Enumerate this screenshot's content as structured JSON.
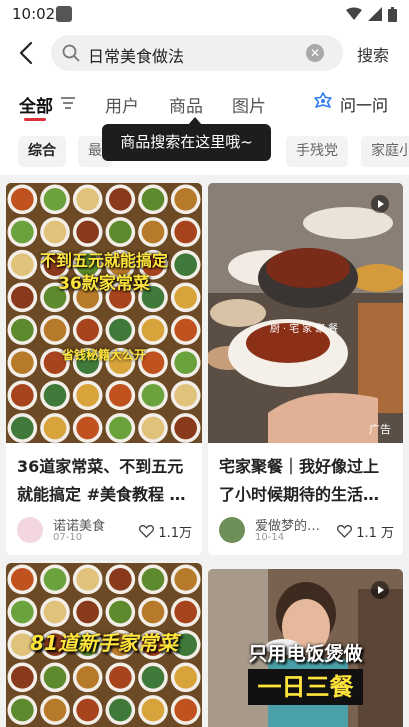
{
  "status": {
    "time": "10:02"
  },
  "search": {
    "query": "日常美食做法",
    "submit_label": "搜索"
  },
  "tabs": {
    "all": "全部",
    "users": "用户",
    "goods": "商品",
    "images": "图片",
    "ask": "问一问"
  },
  "tooltip": "商品搜索在这里哦~",
  "chips": [
    "综合",
    "最",
    "手残党",
    "家庭小"
  ],
  "cards": [
    {
      "title_line1": "36道家常菜、不到五元",
      "title_line2": "就能搞定 #美食教程 …",
      "author": "诺诺美食",
      "date": "07-10",
      "likes": "1.1万",
      "overlay_line1": "不到五元就能搞定",
      "overlay_line2": "36款家常菜",
      "overlay_line3": "省钱秘籍大公开"
    },
    {
      "title_line1": "宅家聚餐｜我好像过上",
      "title_line2": "了小时候期待的生活…",
      "author": "爱做梦的…",
      "date": "10-14",
      "likes": "1.1 万",
      "overlay": "厨·宅家聚餐",
      "ad": "广告"
    },
    {
      "overlay_line1": "81道新手家常菜"
    },
    {
      "overlay_line1": "只用电饭煲做",
      "overlay_line2": "一日三餐"
    }
  ],
  "colors": {
    "accent": "#e0303a",
    "ask_blue": "#2f7bf0",
    "overlay_yellow": "#ffe53b"
  }
}
